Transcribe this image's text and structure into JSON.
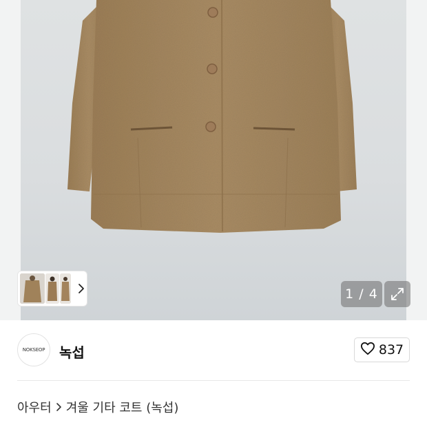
{
  "gallery": {
    "counter": "1 / 4",
    "thumbnail_count": 3
  },
  "shop": {
    "logo_text": "NOKSEOP",
    "name": "녹섭",
    "likes": "837"
  },
  "breadcrumb": {
    "category": "아우터",
    "subcategory": "겨울 기타 코트 (녹섭)"
  },
  "colors": {
    "coat": "#a88a62",
    "wall": "#dadddf",
    "overlay": "#6e6e6e"
  },
  "icons": {
    "thumb_next": "chevron-right-icon",
    "expand": "expand-icon",
    "like": "heart-outline-icon",
    "breadcrumb_sep": "chevron-right-icon"
  }
}
